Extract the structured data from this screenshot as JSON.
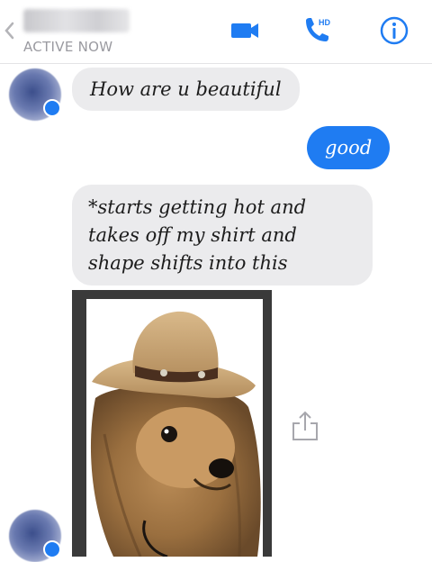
{
  "header": {
    "status": "ACTIVE NOW",
    "hd_badge": "HD",
    "accent_color": "#1f7cf2"
  },
  "icons": {
    "back": "chevron-left-icon",
    "video": "video-camera-icon",
    "call": "phone-hd-icon",
    "info": "info-icon",
    "share": "share-icon"
  },
  "messages": [
    {
      "from": "them",
      "text": "How are u beautiful"
    },
    {
      "from": "me",
      "text": "good"
    },
    {
      "from": "them",
      "text": "*starts getting hot and takes off my shirt and shape shifts into this"
    }
  ],
  "colors": {
    "outgoing_bubble": "#1f7cf2",
    "incoming_bubble": "#ebebed"
  }
}
